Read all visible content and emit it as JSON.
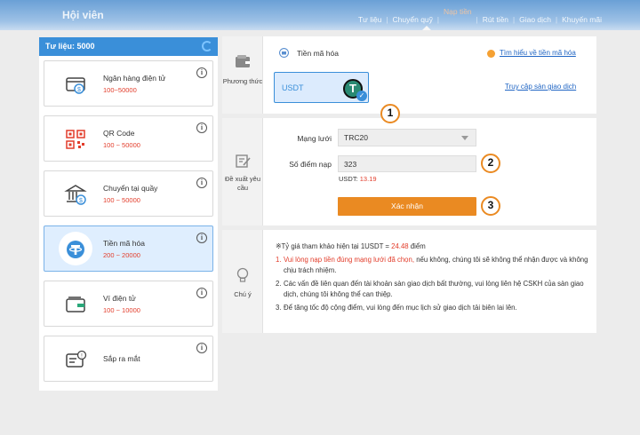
{
  "header": {
    "brand": "Hội viên",
    "nav": [
      {
        "label": "Tư liệu"
      },
      {
        "label": "Chuyển quỹ"
      },
      {
        "label": "Nạp tiền",
        "active": true
      },
      {
        "label": "Rút tiền"
      },
      {
        "label": "Giao dịch"
      },
      {
        "label": "Khuyến mãi"
      }
    ]
  },
  "sidebar": {
    "title": "Tư liệu: 5000",
    "methods": [
      {
        "name": "Ngân hàng điện tử",
        "range": "100~50000",
        "icon": "bank-card-icon"
      },
      {
        "name": "QR Code",
        "range": "100 ~ 50000",
        "icon": "qr-code-icon"
      },
      {
        "name": "Chuyển tại quầy",
        "range": "100 ~ 50000",
        "icon": "bank-counter-icon"
      },
      {
        "name": "Tiền mã hóa",
        "range": "200 ~ 20000",
        "icon": "tether-coin-icon",
        "selected": true
      },
      {
        "name": "Ví điện tử",
        "range": "100 ~ 10000",
        "icon": "wallet-icon"
      },
      {
        "name": "Sắp ra mắt",
        "range": "",
        "icon": "coming-soon-icon"
      }
    ]
  },
  "method_panel": {
    "side_label": "Phương thức",
    "title": "Tiền mã hóa",
    "learn_link": "Tìm hiểu về tiền mã hóa",
    "coin": "USDT",
    "coin_logo": "T",
    "exchange_link": "Truy cập sàn giao dịch"
  },
  "request_panel": {
    "side_label": "Đề xuất yêu cầu",
    "network_label": "Mạng lưới",
    "network_value": "TRC20",
    "points_label": "Số điểm nạp",
    "points_value": "323",
    "usdt_prefix": "USDT:",
    "usdt_value": "13.19",
    "confirm_label": "Xác nhận"
  },
  "markers": [
    "1",
    "2",
    "3"
  ],
  "notes_panel": {
    "side_label": "Chú ý",
    "rate_prefix": "※Tỷ giá tham khảo hiện tại 1USDT = ",
    "rate_value": "24.48",
    "rate_suffix": " điểm",
    "notes": [
      {
        "num": "1.",
        "red": "Vui lòng nạp tiền đúng mạng lưới đã chọn,",
        "text": " nếu không, chúng tôi sẽ không thể nhận được và không chịu trách nhiệm."
      },
      {
        "num": "2.",
        "red": "",
        "text": "Các vấn đề liên quan đến tài khoản sàn giao dịch bất thường, vui lòng liên hệ CSKH của sàn giao dịch, chúng tôi không thể can thiệp."
      },
      {
        "num": "3.",
        "red": "",
        "text": "Để tăng tốc độ cộng điểm, vui lòng đến mục lịch sử giao dịch tải biên lai lên."
      }
    ]
  },
  "colors": {
    "accent": "#3a8fd9",
    "orange": "#ea8a22",
    "red": "#e23c2a"
  }
}
